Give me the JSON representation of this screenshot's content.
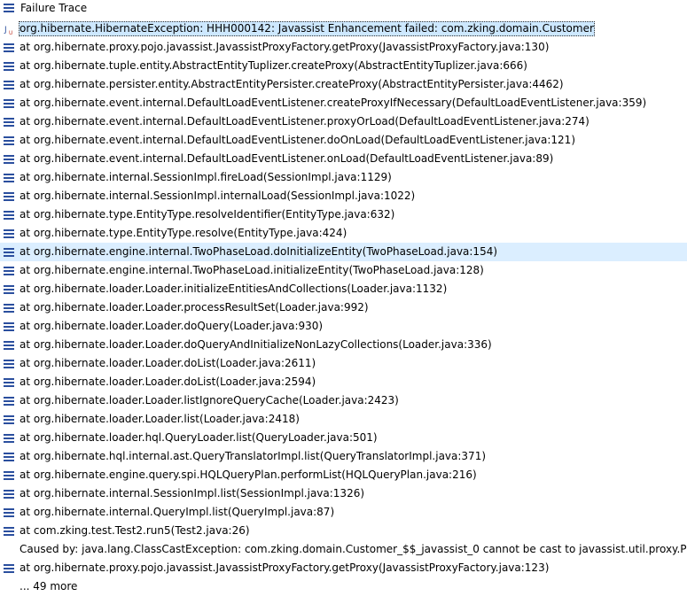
{
  "panel": {
    "title": "Failure Trace",
    "title_icon": "list-icon"
  },
  "trace": [
    {
      "text": "org.hibernate.HibernateException: HHH000142: Javassist Enhancement failed: com.zking.domain.Customer",
      "icon": "junit-icon",
      "selected": true
    },
    {
      "text": "at org.hibernate.proxy.pojo.javassist.JavassistProxyFactory.getProxy(JavassistProxyFactory.java:130)",
      "icon": "stack-frame-icon"
    },
    {
      "text": "at org.hibernate.tuple.entity.AbstractEntityTuplizer.createProxy(AbstractEntityTuplizer.java:666)",
      "icon": "stack-frame-icon"
    },
    {
      "text": "at org.hibernate.persister.entity.AbstractEntityPersister.createProxy(AbstractEntityPersister.java:4462)",
      "icon": "stack-frame-icon"
    },
    {
      "text": "at org.hibernate.event.internal.DefaultLoadEventListener.createProxyIfNecessary(DefaultLoadEventListener.java:359)",
      "icon": "stack-frame-icon"
    },
    {
      "text": "at org.hibernate.event.internal.DefaultLoadEventListener.proxyOrLoad(DefaultLoadEventListener.java:274)",
      "icon": "stack-frame-icon"
    },
    {
      "text": "at org.hibernate.event.internal.DefaultLoadEventListener.doOnLoad(DefaultLoadEventListener.java:121)",
      "icon": "stack-frame-icon"
    },
    {
      "text": "at org.hibernate.event.internal.DefaultLoadEventListener.onLoad(DefaultLoadEventListener.java:89)",
      "icon": "stack-frame-icon"
    },
    {
      "text": "at org.hibernate.internal.SessionImpl.fireLoad(SessionImpl.java:1129)",
      "icon": "stack-frame-icon"
    },
    {
      "text": "at org.hibernate.internal.SessionImpl.internalLoad(SessionImpl.java:1022)",
      "icon": "stack-frame-icon"
    },
    {
      "text": "at org.hibernate.type.EntityType.resolveIdentifier(EntityType.java:632)",
      "icon": "stack-frame-icon"
    },
    {
      "text": "at org.hibernate.type.EntityType.resolve(EntityType.java:424)",
      "icon": "stack-frame-icon"
    },
    {
      "text": "at org.hibernate.engine.internal.TwoPhaseLoad.doInitializeEntity(TwoPhaseLoad.java:154)",
      "icon": "stack-frame-icon",
      "highlighted": true
    },
    {
      "text": "at org.hibernate.engine.internal.TwoPhaseLoad.initializeEntity(TwoPhaseLoad.java:128)",
      "icon": "stack-frame-icon"
    },
    {
      "text": "at org.hibernate.loader.Loader.initializeEntitiesAndCollections(Loader.java:1132)",
      "icon": "stack-frame-icon"
    },
    {
      "text": "at org.hibernate.loader.Loader.processResultSet(Loader.java:992)",
      "icon": "stack-frame-icon"
    },
    {
      "text": "at org.hibernate.loader.Loader.doQuery(Loader.java:930)",
      "icon": "stack-frame-icon"
    },
    {
      "text": "at org.hibernate.loader.Loader.doQueryAndInitializeNonLazyCollections(Loader.java:336)",
      "icon": "stack-frame-icon"
    },
    {
      "text": "at org.hibernate.loader.Loader.doList(Loader.java:2611)",
      "icon": "stack-frame-icon"
    },
    {
      "text": "at org.hibernate.loader.Loader.doList(Loader.java:2594)",
      "icon": "stack-frame-icon"
    },
    {
      "text": "at org.hibernate.loader.Loader.listIgnoreQueryCache(Loader.java:2423)",
      "icon": "stack-frame-icon"
    },
    {
      "text": "at org.hibernate.loader.Loader.list(Loader.java:2418)",
      "icon": "stack-frame-icon"
    },
    {
      "text": "at org.hibernate.loader.hql.QueryLoader.list(QueryLoader.java:501)",
      "icon": "stack-frame-icon"
    },
    {
      "text": "at org.hibernate.hql.internal.ast.QueryTranslatorImpl.list(QueryTranslatorImpl.java:371)",
      "icon": "stack-frame-icon"
    },
    {
      "text": "at org.hibernate.engine.query.spi.HQLQueryPlan.performList(HQLQueryPlan.java:216)",
      "icon": "stack-frame-icon"
    },
    {
      "text": "at org.hibernate.internal.SessionImpl.list(SessionImpl.java:1326)",
      "icon": "stack-frame-icon"
    },
    {
      "text": "at org.hibernate.internal.QueryImpl.list(QueryImpl.java:87)",
      "icon": "stack-frame-icon"
    },
    {
      "text": "at com.zking.test.Test2.run5(Test2.java:26)",
      "icon": "stack-frame-icon"
    },
    {
      "text": "Caused by: java.lang.ClassCastException: com.zking.domain.Customer_$$_javassist_0 cannot be cast to javassist.util.proxy.Proxy",
      "icon": "none"
    },
    {
      "text": "at org.hibernate.proxy.pojo.javassist.JavassistProxyFactory.getProxy(JavassistProxyFactory.java:123)",
      "icon": "stack-frame-icon"
    },
    {
      "text": "... 49 more",
      "icon": "none"
    }
  ],
  "colors": {
    "icon_blue": "#2b4f9e",
    "selection": "#cde8ff",
    "highlight": "#dbeeff"
  }
}
